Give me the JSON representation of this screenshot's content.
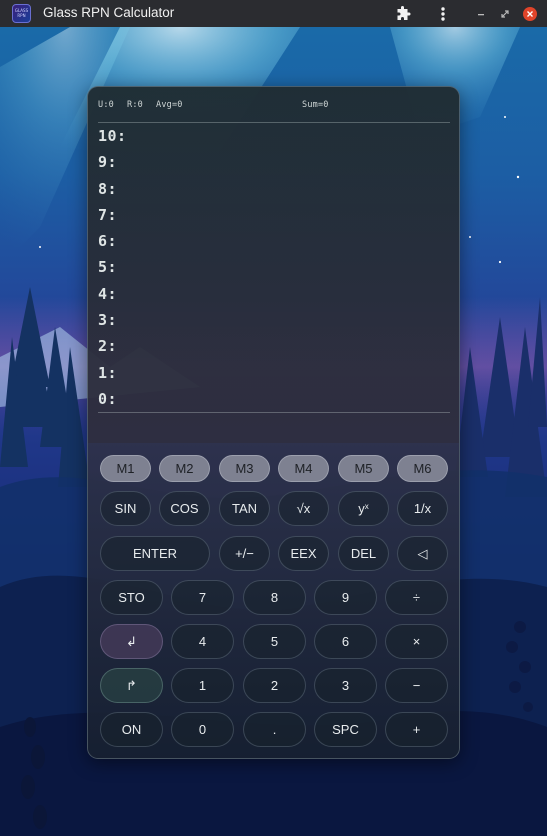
{
  "window": {
    "title": "Glass RPN Calculator",
    "icon_text": "GLASS RPN"
  },
  "titlebar": {
    "icons": [
      "puzzle-icon",
      "more-vert-icon",
      "minimize-icon",
      "restore-icon",
      "close-icon"
    ]
  },
  "status": {
    "u": "U:0",
    "r": "R:0",
    "avg": "Avg=0",
    "sum": "Sum=0"
  },
  "stack": [
    "10:",
    "9:",
    "8:",
    "7:",
    "6:",
    "5:",
    "4:",
    "3:",
    "2:",
    "1:",
    "0:"
  ],
  "memory_keys": [
    "M1",
    "M2",
    "M3",
    "M4",
    "M5",
    "M6"
  ],
  "function_keys": [
    "SIN",
    "COS",
    "TAN",
    "√x",
    "y",
    "1/x"
  ],
  "function_keys_sup": "x",
  "row3": {
    "enter": "ENTER",
    "negate": "+/−",
    "eex": "EEX",
    "del": "DEL",
    "backspace": "◁"
  },
  "row4": [
    "STO",
    "7",
    "8",
    "9",
    "÷"
  ],
  "row5": [
    "↲",
    "4",
    "5",
    "6",
    "×"
  ],
  "row6": [
    "↱",
    "1",
    "2",
    "3",
    "−"
  ],
  "row7": [
    "ON",
    "0",
    ".",
    "SPC",
    "+"
  ],
  "colors": {
    "titlebar": "#2b2c30",
    "close": "#e0442a",
    "memory_key": "#9698a5",
    "shift_left": "#483c5c",
    "shift_right": "#284042"
  }
}
